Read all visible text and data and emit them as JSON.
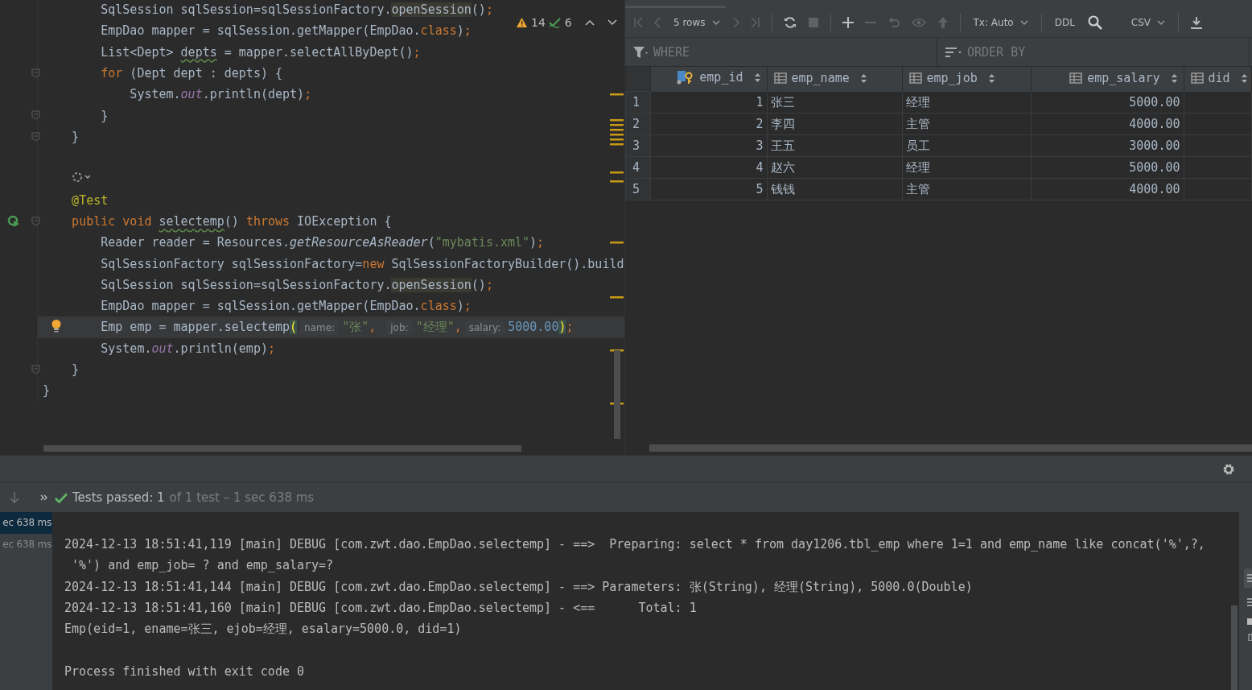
{
  "editor": {
    "inspections": {
      "warnings": "14",
      "weak_warnings": "6"
    },
    "lines": [
      {
        "kind": "code",
        "current": false,
        "segments": [
          {
            "text": "        SqlSession sqlSession=sqlSessionFactory.",
            "kind": "p"
          },
          {
            "text": "openSession",
            "kind": "m"
          },
          {
            "text": "()",
            "kind": "p"
          },
          {
            "text": ";",
            "kind": "k"
          }
        ]
      },
      {
        "kind": "code",
        "current": false,
        "segments": [
          {
            "text": "        EmpDao mapper = sqlSession.getMapper(EmpDao.",
            "kind": "p"
          },
          {
            "text": "class",
            "kind": "k"
          },
          {
            "text": ")",
            "kind": "p"
          },
          {
            "text": ";",
            "kind": "k"
          }
        ]
      },
      {
        "kind": "code",
        "current": false,
        "segments": [
          {
            "text": "        List<Dept> ",
            "kind": "p"
          },
          {
            "text": "depts",
            "kind": "w"
          },
          {
            "text": " = mapper.selectAllByDept()",
            "kind": "p"
          },
          {
            "text": ";",
            "kind": "k"
          }
        ]
      },
      {
        "kind": "fold",
        "current": false,
        "segments": [
          {
            "text": "        for",
            "kind": "k"
          },
          {
            "text": " (Dept dept : depts) {",
            "kind": "p"
          }
        ]
      },
      {
        "kind": "code",
        "current": false,
        "segments": [
          {
            "text": "            System.",
            "kind": "p"
          },
          {
            "text": "out",
            "kind": "o"
          },
          {
            "text": ".println(dept)",
            "kind": "p"
          },
          {
            "text": ";",
            "kind": "k"
          }
        ]
      },
      {
        "kind": "fold",
        "current": false,
        "segments": [
          {
            "text": "        }",
            "kind": "p"
          }
        ]
      },
      {
        "kind": "fold",
        "current": false,
        "segments": [
          {
            "text": "    }",
            "kind": "p"
          }
        ]
      },
      {
        "kind": "blank"
      },
      {
        "kind": "inlay"
      },
      {
        "kind": "code",
        "current": false,
        "segments": [
          {
            "text": "    @Test",
            "kind": "a"
          }
        ]
      },
      {
        "kind": "run",
        "current": false,
        "segments": [
          {
            "text": "    public void ",
            "kind": "k"
          },
          {
            "text": "selectemp",
            "kind": "w"
          },
          {
            "text": "() ",
            "kind": "p"
          },
          {
            "text": "throws",
            "kind": "k"
          },
          {
            "text": " IOException {",
            "kind": "p"
          }
        ]
      },
      {
        "kind": "code",
        "current": false,
        "segments": [
          {
            "text": "        Reader reader = Resources.",
            "kind": "p"
          },
          {
            "text": "getResourceAsReader",
            "kind": "i"
          },
          {
            "text": "(",
            "kind": "p"
          },
          {
            "text": "\"mybatis.xml\"",
            "kind": "s"
          },
          {
            "text": ")",
            "kind": "p"
          },
          {
            "text": ";",
            "kind": "k"
          }
        ]
      },
      {
        "kind": "code",
        "current": false,
        "segments": [
          {
            "text": "        SqlSessionFactory sqlSessionFactory=",
            "kind": "p"
          },
          {
            "text": "new",
            "kind": "k"
          },
          {
            "text": " SqlSessionFactoryBuilder().build",
            "kind": "p"
          }
        ]
      },
      {
        "kind": "code",
        "current": false,
        "segments": [
          {
            "text": "        SqlSession sqlSession=sqlSessionFactory.",
            "kind": "p"
          },
          {
            "text": "openSession",
            "kind": "m"
          },
          {
            "text": "()",
            "kind": "p"
          },
          {
            "text": ";",
            "kind": "k"
          }
        ]
      },
      {
        "kind": "code",
        "current": false,
        "segments": [
          {
            "text": "        EmpDao mapper = sqlSession.getMapper(EmpDao.",
            "kind": "p"
          },
          {
            "text": "class",
            "kind": "k"
          },
          {
            "text": ")",
            "kind": "p"
          },
          {
            "text": ";",
            "kind": "k"
          }
        ]
      },
      {
        "kind": "bulb",
        "current": true,
        "segments": [
          {
            "text": "        Emp emp = mapper.selectemp",
            "kind": "p"
          },
          {
            "text": "(",
            "kind": "b"
          },
          {
            "text": "name:",
            "kind": "h"
          },
          {
            "text": "\"张\"",
            "kind": "s"
          },
          {
            "text": ", ",
            "kind": "k"
          },
          {
            "text": "job:",
            "kind": "h"
          },
          {
            "text": "\"经理\"",
            "kind": "s"
          },
          {
            "text": ",",
            "kind": "k"
          },
          {
            "text": "salary:",
            "kind": "h"
          },
          {
            "text": "5000.00",
            "kind": "n"
          },
          {
            "text": ")",
            "kind": "b"
          },
          {
            "text": ";",
            "kind": "k"
          }
        ]
      },
      {
        "kind": "code",
        "current": false,
        "segments": [
          {
            "text": "        System.",
            "kind": "p"
          },
          {
            "text": "out",
            "kind": "o"
          },
          {
            "text": ".println(emp)",
            "kind": "p"
          },
          {
            "text": ";",
            "kind": "k"
          }
        ]
      },
      {
        "kind": "fold",
        "current": false,
        "segments": [
          {
            "text": "    }",
            "kind": "p"
          }
        ]
      },
      {
        "kind": "code",
        "current": false,
        "segments": [
          {
            "text": "}",
            "kind": "p"
          }
        ]
      }
    ]
  },
  "data_grid": {
    "toolbar": {
      "rows": "5 rows",
      "transaction": "Tx: Auto",
      "ddl": "DDL",
      "export_format": "CSV"
    },
    "where": {
      "placeholder": "WHERE"
    },
    "order_by": {
      "placeholder": "ORDER BY"
    },
    "columns": [
      {
        "name": "emp_id",
        "kind": "key",
        "numeric": true
      },
      {
        "name": "emp_name",
        "kind": "column",
        "numeric": false
      },
      {
        "name": "emp_job",
        "kind": "column",
        "numeric": false
      },
      {
        "name": "emp_salary",
        "kind": "column",
        "numeric": true
      },
      {
        "name": "did",
        "kind": "column"
      }
    ],
    "rows": [
      {
        "number": "1",
        "cells": [
          "1",
          "张三",
          "经理",
          "5000.00"
        ]
      },
      {
        "number": "2",
        "cells": [
          "2",
          "李四",
          "主管",
          "4000.00"
        ]
      },
      {
        "number": "3",
        "cells": [
          "3",
          "王五",
          "员工",
          "3000.00"
        ]
      },
      {
        "number": "4",
        "cells": [
          "4",
          "赵六",
          "经理",
          "5000.00"
        ]
      },
      {
        "number": "5",
        "cells": [
          "5",
          "钱钱",
          "主管",
          "4000.00"
        ]
      }
    ]
  },
  "run_panel": {
    "status": {
      "label": "Tests passed: 1",
      "detail": "of 1 test – 1 sec 638 ms"
    },
    "tests": [
      {
        "text": "ec 638 ms",
        "selected": true
      },
      {
        "text": "ec 638 ms",
        "selected": false
      }
    ],
    "console": [
      {
        "kind": "log",
        "text": "2024-12-13 18:51:41,119 [main] DEBUG [com.zwt.dao.EmpDao.selectemp] - ==>  Preparing: select * from day1206.tbl_emp where 1=1 and emp_name like concat('%',?,"
      },
      {
        "kind": "log",
        "text": " '%') and emp_job= ? and emp_salary=?"
      },
      {
        "kind": "log",
        "text": "2024-12-13 18:51:41,144 [main] DEBUG [com.zwt.dao.EmpDao.selectemp] - ==> Parameters: 张(String), 经理(String), 5000.0(Double)"
      },
      {
        "kind": "log",
        "text": "2024-12-13 18:51:41,160 [main] DEBUG [com.zwt.dao.EmpDao.selectemp] - <==      Total: 1"
      },
      {
        "kind": "log",
        "text": "Emp(eid=1, ename=张三, ejob=经理, esalary=5000.0, did=1)"
      },
      {
        "kind": "exit",
        "text": "Process finished with exit code 0"
      }
    ]
  }
}
